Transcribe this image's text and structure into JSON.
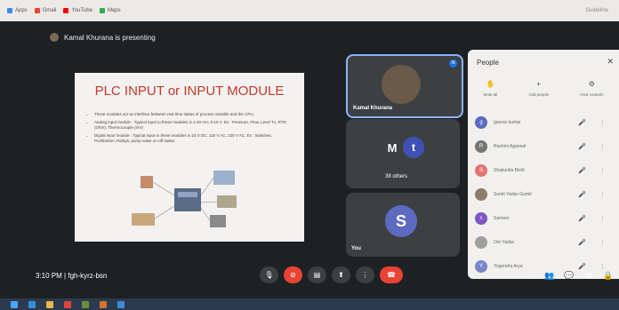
{
  "bookmarks": [
    {
      "label": "Apps",
      "color": "#4285f4"
    },
    {
      "label": "Gmail",
      "color": "#ea4335"
    },
    {
      "label": "YouTube",
      "color": "#ff0000"
    },
    {
      "label": "Maps",
      "color": "#34a853"
    }
  ],
  "bookmarks_right": "Guideline",
  "presenting": {
    "text": "Kamal Khurana is presenting"
  },
  "slide": {
    "title": "PLC INPUT or INPUT MODULE",
    "bullets": [
      "These modules act as interface between real time status of process variable and the CPU.",
      "Analog input module : Typical input to these modules is 4-20 mA, 0-10 V. Ex : Pressure, Flow, Level Tx, RTD (Ohm), Thermocouple (mV)",
      "Digital input module : Typical input to these modules is 24 V DC, 115 V AC, 230 V AC. Ex : Switches, Pushbutton, Relays, pump valve on-off status"
    ]
  },
  "tiles": {
    "presenter_name": "Kamal Khurana",
    "others_initials": [
      "M",
      "t"
    ],
    "others_label": "38 others",
    "you_initial": "S",
    "you_label": "You"
  },
  "bottom": {
    "time": "3:10 PM",
    "separator": "|",
    "meeting_code": "fgh-kyrz-bsn"
  },
  "people_panel": {
    "title": "People",
    "actions": [
      "Mute all",
      "Add people",
      "Host controls"
    ],
    "participants": [
      {
        "name": "gaurav kumar",
        "initial": "g",
        "color": "#5c6bc0"
      },
      {
        "name": "Rashmi Agarwal",
        "initial": "R",
        "color": "#757575"
      },
      {
        "name": "Shakuntla Bisht",
        "initial": "S",
        "color": "#e57373"
      },
      {
        "name": "Sumit Yadav Gumti",
        "initial": "",
        "color": "#8d7b6b"
      },
      {
        "name": "Sameer",
        "initial": "s",
        "color": "#7e57c2"
      },
      {
        "name": "Om Yadav",
        "initial": "",
        "color": "#9e9e9e"
      },
      {
        "name": "Yogendra Arya",
        "initial": "Y",
        "color": "#7986cb"
      }
    ]
  },
  "colors": {
    "accent": "#8ab4f8",
    "danger": "#ea4335",
    "bg": "#1e2124"
  }
}
